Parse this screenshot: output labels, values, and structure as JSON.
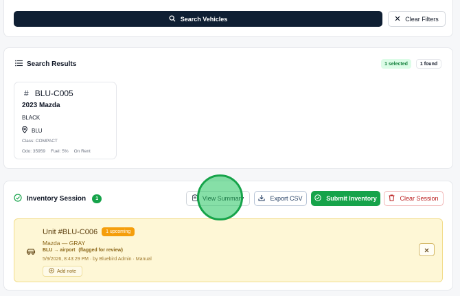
{
  "search": {
    "button_label": "Search Vehicles",
    "clear_label": "Clear Filters"
  },
  "results": {
    "title": "Search Results",
    "selected_badge": "1 selected",
    "found_badge": "1 found",
    "vehicles": [
      {
        "id": "BLU-C005",
        "model": "2023 Mazda",
        "color": "BLACK",
        "location": "BLU",
        "class": "Class: COMPACT",
        "odo": "Odo: 35959",
        "fuel": "Fuel: 5%",
        "status": "On Rent"
      }
    ]
  },
  "session": {
    "title": "Inventory Session",
    "count": "1",
    "view_summary_label": "View Summary",
    "export_label": "Export CSV",
    "submit_label": "Submit Inventory",
    "clear_label": "Clear Session",
    "units": [
      {
        "title": "Unit #BLU-C006",
        "badge": "1 upcoming",
        "model": "Mazda — GRAY",
        "route_from": "BLU",
        "route_arrow": "→",
        "route_to": "airport",
        "route_note": "(flagged for review)",
        "meta": "5/9/2026, 8:43:29 PM · by Bluebird Admin · Manual",
        "add_note_label": "Add note"
      }
    ]
  },
  "colors": {
    "primary_dark": "#0f1f33",
    "success": "#16a34a",
    "danger": "#b91c1c",
    "warning_bg": "#fef7d6",
    "badge_amber": "#f59e0b"
  },
  "icons": {
    "search": "search-icon",
    "clear": "close-icon",
    "results": "list-icon",
    "vehicle_id": "hash-icon",
    "location": "map-pin-icon",
    "session": "check-circle-icon",
    "summary": "clipboard-icon",
    "export": "download-icon",
    "submit": "check-circle-icon",
    "clear_session": "trash-icon",
    "car": "car-icon",
    "add_note": "plus-circle-icon",
    "remove": "close-icon"
  }
}
